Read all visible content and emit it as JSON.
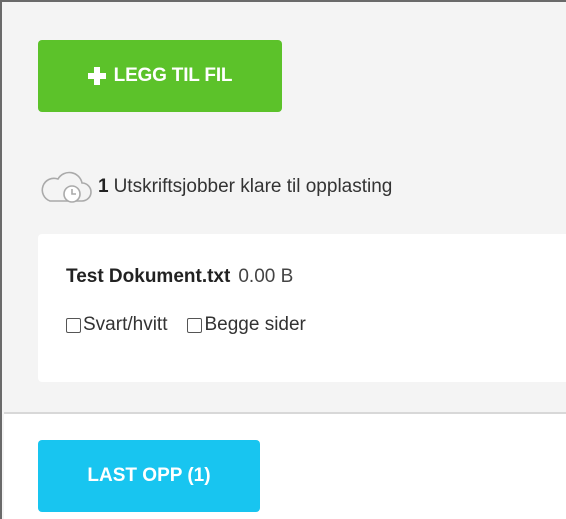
{
  "toolbar": {
    "add_file_label": "LEGG TIL FIL",
    "add_file_icon": "plus-icon",
    "add_file_color": "#5cc22a"
  },
  "status": {
    "icon": "cloud-clock-icon",
    "count": "1",
    "text": "Utskriftsjobber klare til opplasting"
  },
  "jobs": [
    {
      "filename": "Test Dokument.txt",
      "size": "0.00 B",
      "options": [
        {
          "label": "Svart/hvitt",
          "checked": false
        },
        {
          "label": "Begge sider",
          "checked": false
        }
      ]
    }
  ],
  "footer": {
    "upload_label": "LAST OPP (1)",
    "upload_color": "#18c5f0"
  }
}
